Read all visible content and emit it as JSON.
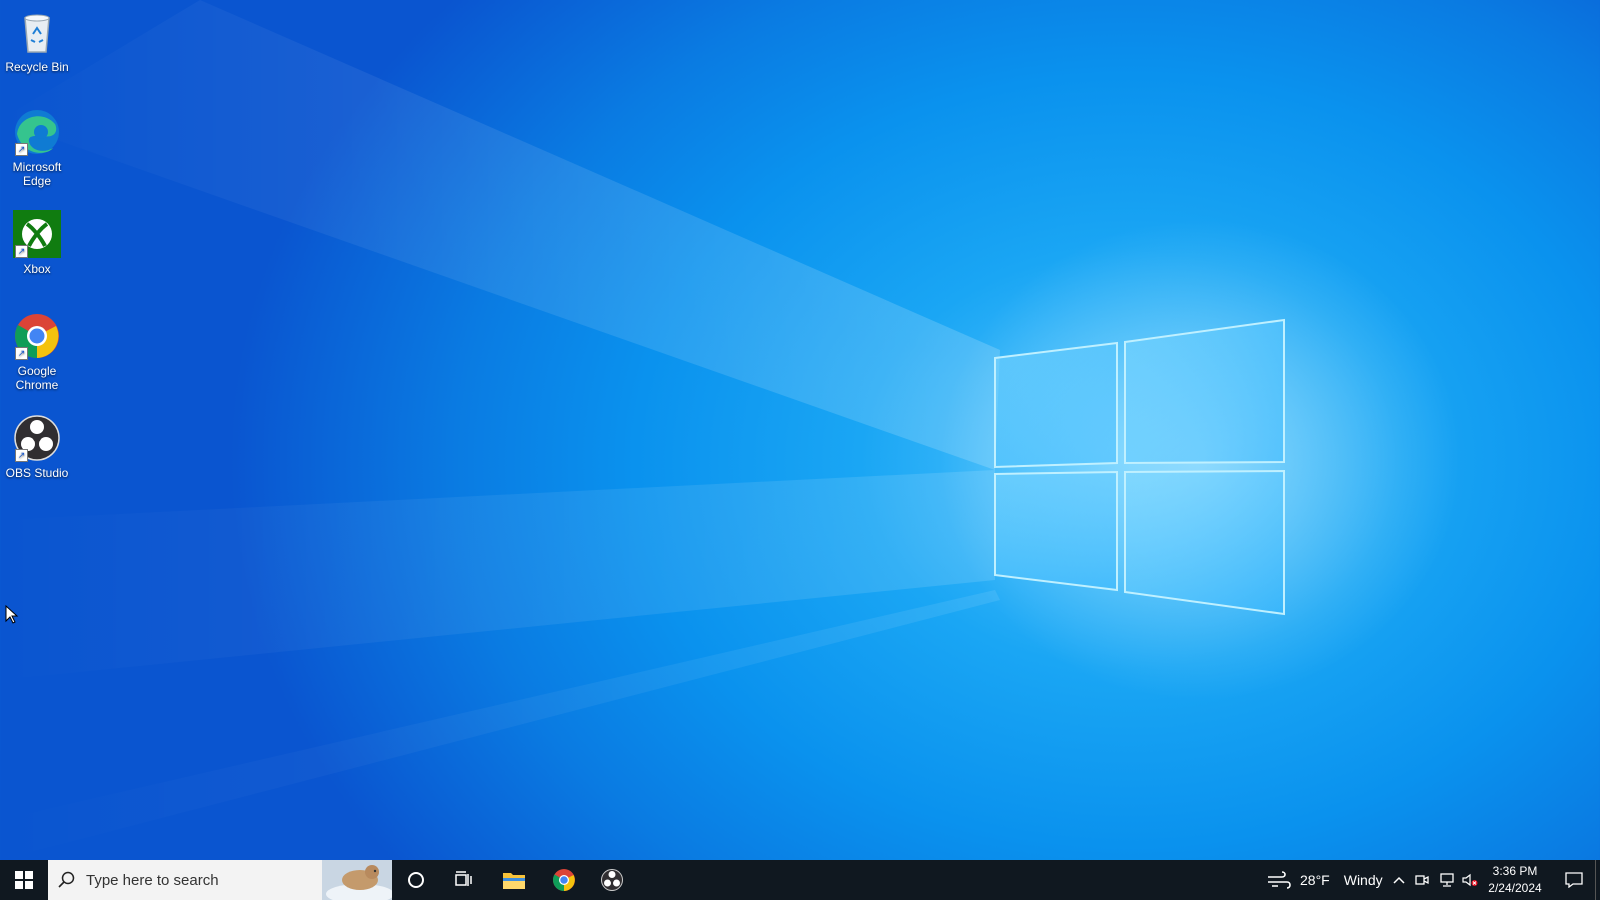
{
  "desktop": {
    "icons": [
      {
        "label": "Recycle Bin",
        "icon": "recycle-bin-icon"
      },
      {
        "label": "Microsoft Edge",
        "icon": "edge-icon"
      },
      {
        "label": "Xbox",
        "icon": "xbox-icon"
      },
      {
        "label": "Google Chrome",
        "icon": "chrome-icon"
      },
      {
        "label": "OBS Studio",
        "icon": "obs-icon"
      }
    ]
  },
  "taskbar": {
    "search_placeholder": "Type here to search",
    "pinned": [
      "start-icon",
      "cortana-icon",
      "task-view-icon",
      "file-explorer-icon",
      "chrome-icon",
      "obs-icon"
    ],
    "weather": {
      "temperature": "28°F",
      "condition": "Windy"
    },
    "clock": {
      "time": "3:36 PM",
      "date": "2/24/2024"
    }
  },
  "colors": {
    "wallpaper_accent": "#0a92ee",
    "taskbar_bg": "#101820"
  }
}
